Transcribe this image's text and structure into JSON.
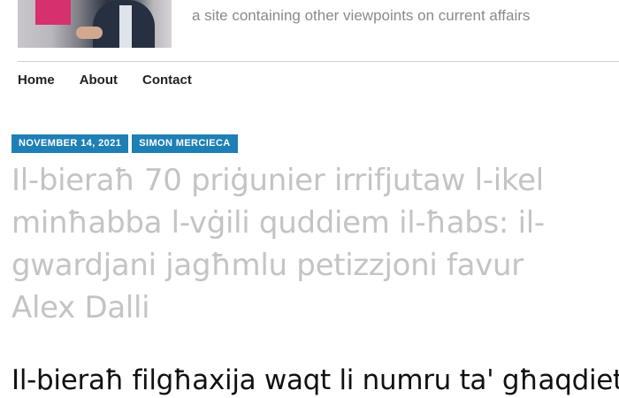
{
  "site": {
    "tagline": "a site containing other viewpoints on current affairs"
  },
  "nav": {
    "items": [
      {
        "label": "Home"
      },
      {
        "label": "About"
      },
      {
        "label": "Contact"
      }
    ]
  },
  "post": {
    "date": "NOVEMBER 14, 2021",
    "author": "SIMON MERCIECA",
    "title": "Il-bieraħ 70 priġunier irrifjutaw l-ikel minħabba l-vġili quddiem il-ħabs: il-gwardjani jagħmlu petizzjoni favur Alex Dalli",
    "subheading": "Il-bieraħ filgħaxija waqt li numru ta' għaqdiet"
  },
  "colors": {
    "badge_bg": "#1e7fb5",
    "title_color": "#c4c4c4"
  }
}
